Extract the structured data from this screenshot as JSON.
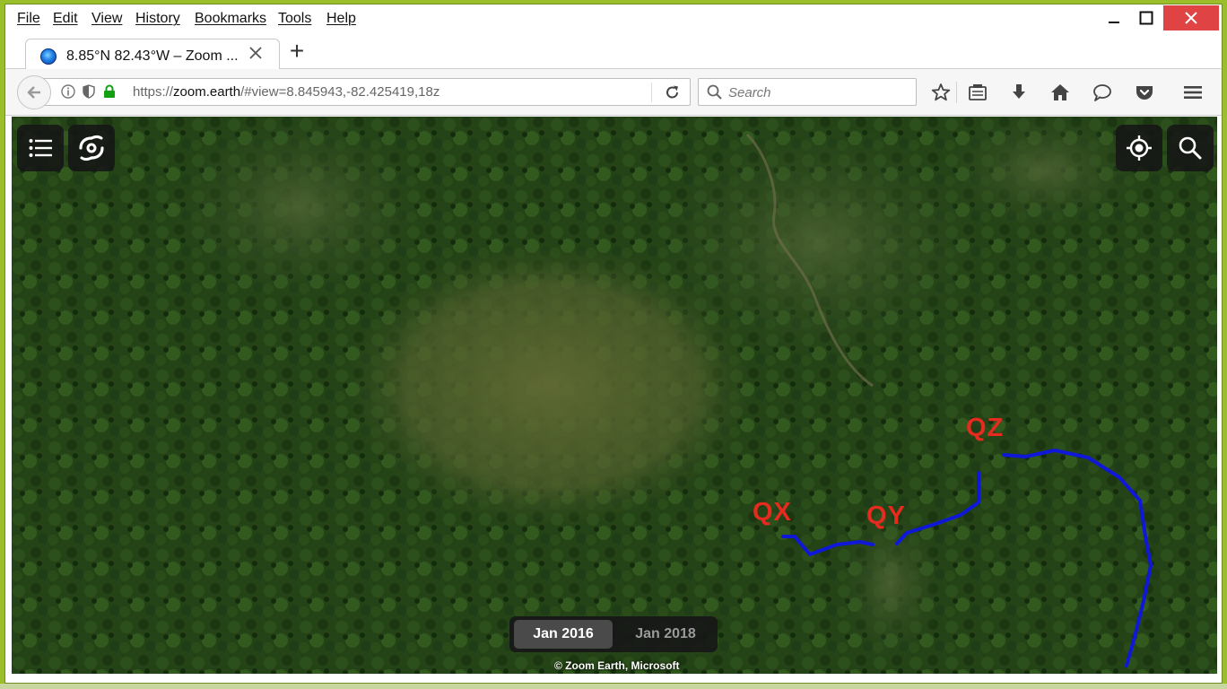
{
  "menubar": {
    "items": [
      "File",
      "Edit",
      "View",
      "History",
      "Bookmarks",
      "Tools",
      "Help"
    ]
  },
  "window_controls": {
    "minimize": "minimize-icon",
    "maximize": "maximize-icon",
    "close": "close-icon"
  },
  "tab": {
    "title": "8.85°N 82.43°W – Zoom ...",
    "close_icon": "close-icon",
    "new_tab_label": "+"
  },
  "nav": {
    "url_prefix": "https://",
    "url_host": "zoom.earth",
    "url_path": "/#view=8.845943,-82.425419,18z",
    "search_placeholder": "Search"
  },
  "map": {
    "labels": {
      "qx": "QX",
      "qy": "QY",
      "qz": "QZ"
    },
    "date_toggle": {
      "active": "Jan 2016",
      "inactive": "Jan 2018"
    },
    "attribution": "© Zoom Earth, Microsoft"
  },
  "colors": {
    "accent_close": "#e04343",
    "label_red": "#e52a1f",
    "route_blue": "#1018d8",
    "foliage": "#2e5a20"
  }
}
